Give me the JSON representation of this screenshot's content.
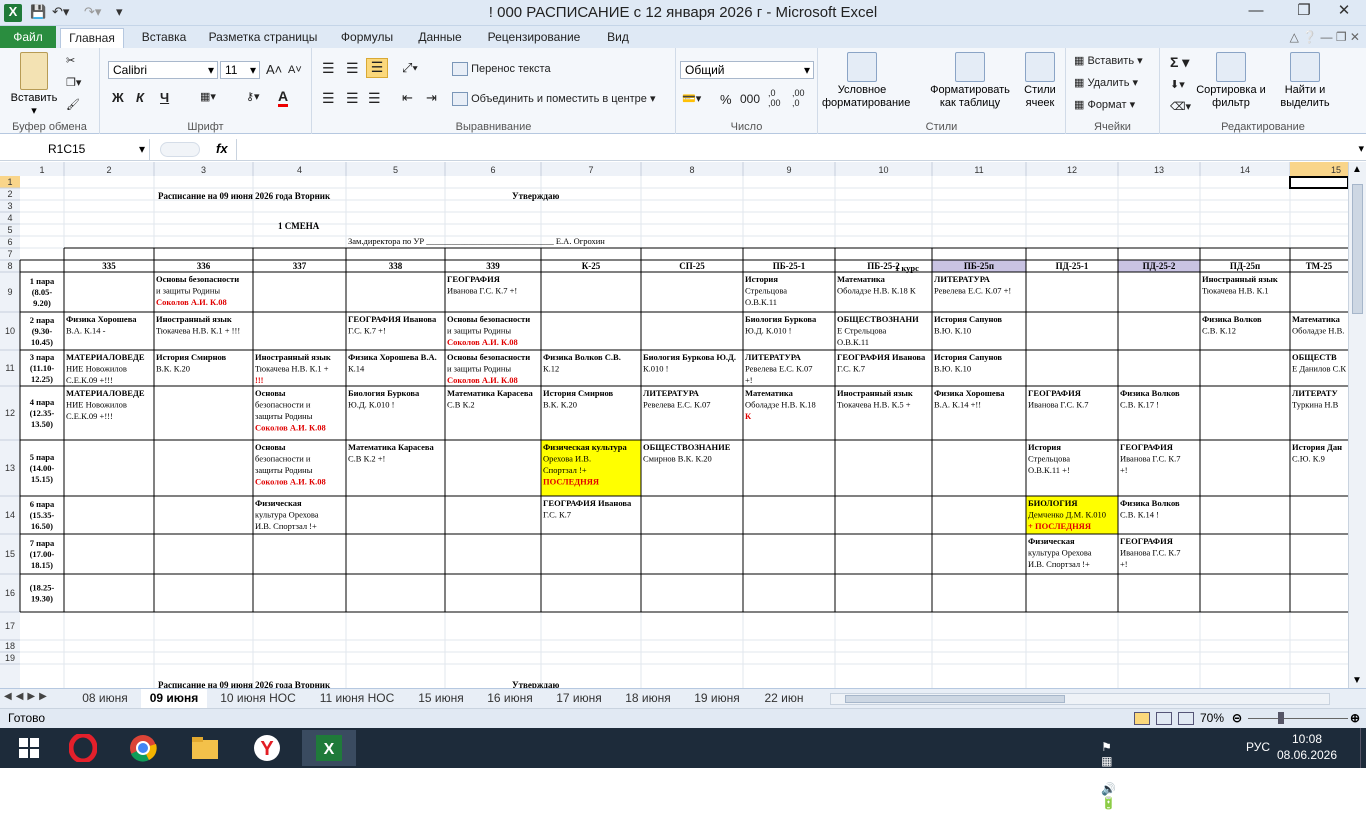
{
  "window": {
    "title": "! 000 РАСПИСАНИЕ с 12 января 2026 г  -  Microsoft Excel"
  },
  "tabs": [
    "Файл",
    "Главная",
    "Вставка",
    "Разметка страницы",
    "Формулы",
    "Данные",
    "Рецензирование",
    "Вид"
  ],
  "ribbon": {
    "groups": {
      "clipboard": "Буфер обмена",
      "font": "Шрифт",
      "alignment": "Выравнивание",
      "number": "Число",
      "styles": "Стили",
      "cells": "Ячейки",
      "editing": "Редактирование"
    },
    "paste": "Вставить",
    "font_name": "Calibri",
    "font_size": "11",
    "wrap_text": "Перенос текста",
    "merge_center": "Объединить и поместить в центре",
    "number_format": "Общий",
    "cond_format": "Условное форматирование",
    "format_table": "Форматировать как таблицу",
    "cell_styles": "Стили ячеек",
    "insert": "Вставить",
    "delete": "Удалить",
    "format": "Формат",
    "sort_filter": "Сортировка и фильтр",
    "find_select": "Найти и выделить",
    "bold": "Ж",
    "italic": "К",
    "underline": "Ч",
    "percent": "%",
    "thousands": "000",
    "inc_dec": ",0 ,00",
    "dec_dec": ",00 ,0",
    "sum": "Σ"
  },
  "formula_bar": {
    "name_box": "R1C15",
    "fx": "fx",
    "value": ""
  },
  "col_headers": [
    "1",
    "2",
    "3",
    "4",
    "5",
    "6",
    "7",
    "8",
    "9",
    "10",
    "11",
    "12",
    "13",
    "14",
    "15"
  ],
  "row_headers": [
    "1",
    "2",
    "3",
    "4",
    "5",
    "6",
    "7",
    "8",
    "9",
    "10",
    "11",
    "12",
    "13",
    "14",
    "15",
    "16",
    "17",
    "18",
    "19"
  ],
  "header_texts": {
    "r2_title": "Расписание на 09 июня 2026 года  Вторник",
    "r2_approve": "Утверждаю",
    "r4_shift": "1 СМЕНА",
    "r5_deputy": "Зам.директора по УР  ______________________________  Е.А. Огрохин",
    "r7_course": "1 курс",
    "r19_title": "Расписание на 09 июня 2026 года  Вторник",
    "r19_approve": "Утверждаю"
  },
  "groups_row": [
    "335",
    "336",
    "337",
    "338",
    "339",
    "К-25",
    "СП-25",
    "ПБ-25-1",
    "ПБ-25-2",
    "ПБ-25п",
    "ПД-25-1",
    "ПД-25-2",
    "ПД-25п",
    "ТМ-25"
  ],
  "highlighted_groups": [
    "ПБ-25п",
    "ПД-25-2"
  ],
  "periods": [
    {
      "name": "1 пара",
      "time": "(8.05-",
      "time2": "9.20)"
    },
    {
      "name": "2 пара",
      "time": "(9.30-",
      "time2": "10.45)"
    },
    {
      "name": "3 пара",
      "time": "(11.10-",
      "time2": "12.25)"
    },
    {
      "name": "4 пара",
      "time": "(12.35-",
      "time2": "13.50)"
    },
    {
      "name": "5 пара",
      "time": "(14.00-",
      "time2": "15.15)"
    },
    {
      "name": "6 пара",
      "time": "(15.35-",
      "time2": "16.50)"
    },
    {
      "name": "7 пара",
      "time": "(17.00-",
      "time2": "18.15)"
    },
    {
      "name": "",
      "time": "(18.25-",
      "time2": "19.30)"
    }
  ],
  "cells": [
    {
      "r": 0,
      "c": 1,
      "lines": [
        [
          "Основы безопасности",
          ""
        ],
        [
          "и защиты Родины",
          ""
        ],
        [
          "Соколов А.И. К.08",
          "red"
        ]
      ]
    },
    {
      "r": 0,
      "c": 4,
      "lines": [
        [
          "ГЕОГРАФИЯ",
          ""
        ],
        [
          "Иванова Г.С. К.7 +!",
          ""
        ]
      ]
    },
    {
      "r": 0,
      "c": 7,
      "lines": [
        [
          "История",
          ""
        ],
        [
          "Стрельцова",
          ""
        ],
        [
          "О.В.К.11",
          ""
        ]
      ]
    },
    {
      "r": 0,
      "c": 8,
      "lines": [
        [
          "Математика",
          ""
        ],
        [
          "Оболадзе Н.В. К.18 К",
          ""
        ]
      ]
    },
    {
      "r": 0,
      "c": 9,
      "lines": [
        [
          "ЛИТЕРАТУРА",
          ""
        ],
        [
          "Ревелева Е.С. К.07 +!",
          ""
        ]
      ]
    },
    {
      "r": 0,
      "c": 12,
      "lines": [
        [
          "Иностранный язык",
          ""
        ],
        [
          "Тюкачева Н.В. К.1",
          ""
        ]
      ]
    },
    {
      "r": 1,
      "c": 0,
      "lines": [
        [
          "Физика Хорошева",
          ""
        ],
        [
          "В.А. К.14 -",
          ""
        ]
      ]
    },
    {
      "r": 1,
      "c": 1,
      "lines": [
        [
          "Иностранный язык",
          ""
        ],
        [
          "Тюкачева Н.В. К.1 + !!!",
          ""
        ]
      ]
    },
    {
      "r": 1,
      "c": 3,
      "lines": [
        [
          "ГЕОГРАФИЯ Иванова",
          ""
        ],
        [
          "Г.С. К.7 +!",
          ""
        ]
      ]
    },
    {
      "r": 1,
      "c": 4,
      "lines": [
        [
          "Основы безопасности",
          ""
        ],
        [
          "и защиты Родины",
          ""
        ],
        [
          "Соколов А.И. К.08",
          "red"
        ]
      ]
    },
    {
      "r": 1,
      "c": 7,
      "lines": [
        [
          "Биология Буркова",
          ""
        ],
        [
          "Ю.Д. К.010 !",
          ""
        ]
      ]
    },
    {
      "r": 1,
      "c": 8,
      "lines": [
        [
          "ОБЩЕСТВОЗНАНИ",
          ""
        ],
        [
          "Е Стрельцова",
          ""
        ],
        [
          "О.В.К.11",
          ""
        ]
      ]
    },
    {
      "r": 1,
      "c": 9,
      "lines": [
        [
          "История Сапунов",
          ""
        ],
        [
          "В.Ю. К.10",
          ""
        ]
      ]
    },
    {
      "r": 1,
      "c": 12,
      "lines": [
        [
          "Физика   Волков",
          ""
        ],
        [
          "С.В. К.12",
          ""
        ]
      ]
    },
    {
      "r": 1,
      "c": 13,
      "lines": [
        [
          "Математика",
          ""
        ],
        [
          "Оболадзе Н.В.",
          ""
        ]
      ]
    },
    {
      "r": 2,
      "c": 0,
      "lines": [
        [
          "МАТЕРИАЛОВЕДЕ",
          ""
        ],
        [
          "НИЕ Новожилов",
          ""
        ],
        [
          "С.Е.К.09 +!!!",
          ""
        ]
      ]
    },
    {
      "r": 2,
      "c": 1,
      "lines": [
        [
          "История Смирнов",
          ""
        ],
        [
          "В.К. К.20",
          ""
        ]
      ]
    },
    {
      "r": 2,
      "c": 2,
      "lines": [
        [
          "Иностранный язык",
          ""
        ],
        [
          "Тюкачева Н.В. К.1 +",
          ""
        ],
        [
          "!!!",
          "red"
        ]
      ]
    },
    {
      "r": 2,
      "c": 3,
      "lines": [
        [
          "Физика Хорошева В.А.",
          ""
        ],
        [
          "К.14",
          ""
        ]
      ]
    },
    {
      "r": 2,
      "c": 4,
      "lines": [
        [
          "Основы безопасности",
          ""
        ],
        [
          "и защиты Родины",
          ""
        ],
        [
          "Соколов А.И. К.08",
          "red"
        ]
      ]
    },
    {
      "r": 2,
      "c": 5,
      "lines": [
        [
          "Физика   Волков С.В.",
          ""
        ],
        [
          "К.12",
          ""
        ]
      ]
    },
    {
      "r": 2,
      "c": 6,
      "lines": [
        [
          "Биология Буркова Ю.Д.",
          ""
        ],
        [
          "К.010 !",
          ""
        ]
      ]
    },
    {
      "r": 2,
      "c": 7,
      "lines": [
        [
          "ЛИТЕРАТУРА",
          ""
        ],
        [
          "Ревелева Е.С. К.07",
          ""
        ],
        [
          "+!",
          ""
        ]
      ]
    },
    {
      "r": 2,
      "c": 8,
      "lines": [
        [
          "ГЕОГРАФИЯ Иванова",
          ""
        ],
        [
          "Г.С. К.7",
          ""
        ]
      ]
    },
    {
      "r": 2,
      "c": 9,
      "lines": [
        [
          "История Сапунов",
          ""
        ],
        [
          "В.Ю. К.10",
          ""
        ]
      ]
    },
    {
      "r": 2,
      "c": 13,
      "lines": [
        [
          "ОБЩЕСТВ",
          ""
        ],
        [
          "Е Данилов С.К",
          ""
        ]
      ]
    },
    {
      "r": 3,
      "c": 0,
      "lines": [
        [
          "МАТЕРИАЛОВЕДЕ",
          ""
        ],
        [
          "НИЕ Новожилов",
          ""
        ],
        [
          "С.Е.К.09 +!!!",
          ""
        ]
      ]
    },
    {
      "r": 3,
      "c": 2,
      "lines": [
        [
          "Основы",
          ""
        ],
        [
          "безопасности и",
          ""
        ],
        [
          "защиты Родины",
          ""
        ],
        [
          "Соколов А.И. К.08",
          "red"
        ]
      ]
    },
    {
      "r": 3,
      "c": 3,
      "lines": [
        [
          "Биология Буркова",
          ""
        ],
        [
          "Ю.Д. К.010 !",
          ""
        ]
      ]
    },
    {
      "r": 3,
      "c": 4,
      "lines": [
        [
          "Математика Карасева",
          ""
        ],
        [
          "С.В К.2",
          ""
        ]
      ]
    },
    {
      "r": 3,
      "c": 5,
      "lines": [
        [
          "История Смирнов",
          ""
        ],
        [
          "В.К. К.20",
          ""
        ]
      ]
    },
    {
      "r": 3,
      "c": 6,
      "lines": [
        [
          "ЛИТЕРАТУРА",
          ""
        ],
        [
          "Ревелева Е.С. К.07",
          ""
        ]
      ]
    },
    {
      "r": 3,
      "c": 7,
      "lines": [
        [
          "Математика",
          ""
        ],
        [
          "Оболадзе Н.В. К.18",
          ""
        ],
        [
          "К",
          "red"
        ]
      ]
    },
    {
      "r": 3,
      "c": 8,
      "lines": [
        [
          "Иностранный язык",
          ""
        ],
        [
          "Тюкачева Н.В. К.5 +",
          ""
        ]
      ]
    },
    {
      "r": 3,
      "c": 9,
      "lines": [
        [
          "Физика Хорошева",
          ""
        ],
        [
          "В.А. К.14 +!!",
          ""
        ]
      ]
    },
    {
      "r": 3,
      "c": 10,
      "lines": [
        [
          "ГЕОГРАФИЯ",
          ""
        ],
        [
          "Иванова Г.С. К.7",
          ""
        ]
      ]
    },
    {
      "r": 3,
      "c": 11,
      "lines": [
        [
          "Физика   Волков",
          ""
        ],
        [
          "С.В. К.17 !",
          ""
        ]
      ]
    },
    {
      "r": 3,
      "c": 13,
      "lines": [
        [
          "ЛИТЕРАТУ",
          ""
        ],
        [
          "Туркина Н.В",
          ""
        ]
      ]
    },
    {
      "r": 4,
      "c": 2,
      "lines": [
        [
          "Основы",
          ""
        ],
        [
          "безопасности и",
          ""
        ],
        [
          "защиты Родины",
          ""
        ],
        [
          "Соколов А.И. К.08",
          "red"
        ]
      ]
    },
    {
      "r": 4,
      "c": 3,
      "lines": [
        [
          "Математика Карасева",
          ""
        ],
        [
          "С.В К.2 +!",
          ""
        ]
      ]
    },
    {
      "r": 4,
      "c": 5,
      "yellow": true,
      "lines": [
        [
          "Физическая культура",
          ""
        ],
        [
          "Орехова И.В.",
          ""
        ],
        [
          "Спортзал !+",
          ""
        ],
        [
          "ПОСЛЕДНЯЯ",
          "red"
        ]
      ]
    },
    {
      "r": 4,
      "c": 6,
      "lines": [
        [
          "ОБЩЕСТВОЗНАНИЕ",
          ""
        ],
        [
          "Смирнов В.К. К.20",
          ""
        ]
      ]
    },
    {
      "r": 4,
      "c": 10,
      "lines": [
        [
          "История",
          ""
        ],
        [
          "Стрельцова",
          ""
        ],
        [
          "О.В.К.11 +!",
          ""
        ]
      ]
    },
    {
      "r": 4,
      "c": 11,
      "lines": [
        [
          "ГЕОГРАФИЯ",
          ""
        ],
        [
          "Иванова Г.С. К.7",
          ""
        ],
        [
          "+!",
          ""
        ]
      ]
    },
    {
      "r": 4,
      "c": 13,
      "lines": [
        [
          "История Дан",
          ""
        ],
        [
          "С.Ю. К.9",
          ""
        ]
      ]
    },
    {
      "r": 5,
      "c": 2,
      "lines": [
        [
          "Физическая",
          ""
        ],
        [
          "культура Орехова",
          ""
        ],
        [
          "И.В. Спортзал !+",
          ""
        ]
      ]
    },
    {
      "r": 5,
      "c": 5,
      "lines": [
        [
          "ГЕОГРАФИЯ Иванова",
          ""
        ],
        [
          "Г.С. К.7",
          ""
        ]
      ]
    },
    {
      "r": 5,
      "c": 10,
      "yellow": true,
      "lines": [
        [
          "БИОЛОГИЯ",
          ""
        ],
        [
          "Демченко Д.М. К.010",
          ""
        ],
        [
          "+ ПОСЛЕДНЯЯ",
          "red"
        ]
      ]
    },
    {
      "r": 5,
      "c": 11,
      "lines": [
        [
          "Физика   Волков",
          ""
        ],
        [
          "С.В. К.14 !",
          ""
        ]
      ]
    },
    {
      "r": 6,
      "c": 10,
      "lines": [
        [
          "Физическая",
          ""
        ],
        [
          "культура Орехова",
          ""
        ],
        [
          "И.В. Спортзал !+",
          ""
        ]
      ]
    },
    {
      "r": 6,
      "c": 11,
      "lines": [
        [
          "ГЕОГРАФИЯ",
          ""
        ],
        [
          "Иванова Г.С. К.7",
          ""
        ],
        [
          "+!",
          ""
        ]
      ]
    }
  ],
  "sheet_tabs": [
    "08 июня",
    "09 июня",
    "10 июня НОС",
    "11 июня НОС",
    "15 июня",
    "16 июня",
    "17 июня",
    "18 июня",
    "19 июня",
    "22 июн"
  ],
  "active_sheet": "09 июня",
  "status": {
    "ready": "Готово",
    "zoom": "70%"
  },
  "taskbar": {
    "lang": "РУС",
    "time": "10:08",
    "date": "08.06.2026"
  },
  "colors": {
    "accent_green": "#2a8d3f",
    "yellow": "#ffff00",
    "red": "#e00000",
    "highlight_header": "#c9c3e3"
  }
}
